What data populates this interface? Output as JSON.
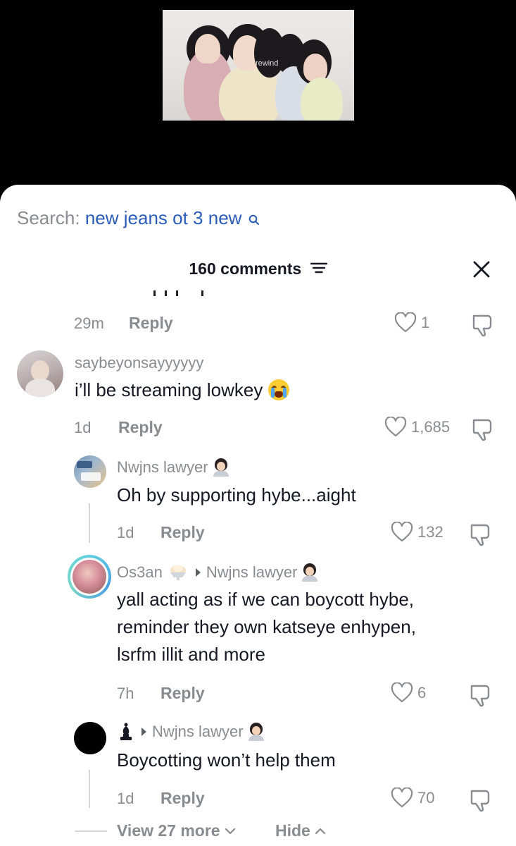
{
  "video": {
    "overlay_text": "rewind"
  },
  "search": {
    "label": "Search:",
    "query": "new jeans ot 3 new"
  },
  "header": {
    "comments_count": "160",
    "comments_label": "comments"
  },
  "comments": [
    {
      "time": "29m",
      "reply": "Reply",
      "likes": "1"
    },
    {
      "username": "saybeyonsayyyyyy",
      "text": "i’ll be streaming lowkey",
      "time": "1d",
      "reply": "Reply",
      "likes": "1,685"
    },
    {
      "username": "Nwjns lawyer",
      "text": "Oh by supporting hybe...aight",
      "time": "1d",
      "reply": "Reply",
      "likes": "132"
    },
    {
      "username": "Os3an",
      "reply_to": "Nwjns lawyer",
      "text_lines": [
        "yall acting as if we can boycott hybe,",
        "reminder they own katseye enhypen,",
        "lsrfm illit and more"
      ],
      "time": "7h",
      "reply": "Reply",
      "likes": "6"
    },
    {
      "username": "♝",
      "reply_to": "Nwjns lawyer",
      "text": "Boycotting won’t help them",
      "time": "1d",
      "reply": "Reply",
      "likes": "70"
    }
  ],
  "footer": {
    "view_more": "View 27 more",
    "hide": "Hide"
  },
  "colors": {
    "link_blue": "#2b5cb8",
    "text": "#161823",
    "secondary": "#8a8b91"
  }
}
